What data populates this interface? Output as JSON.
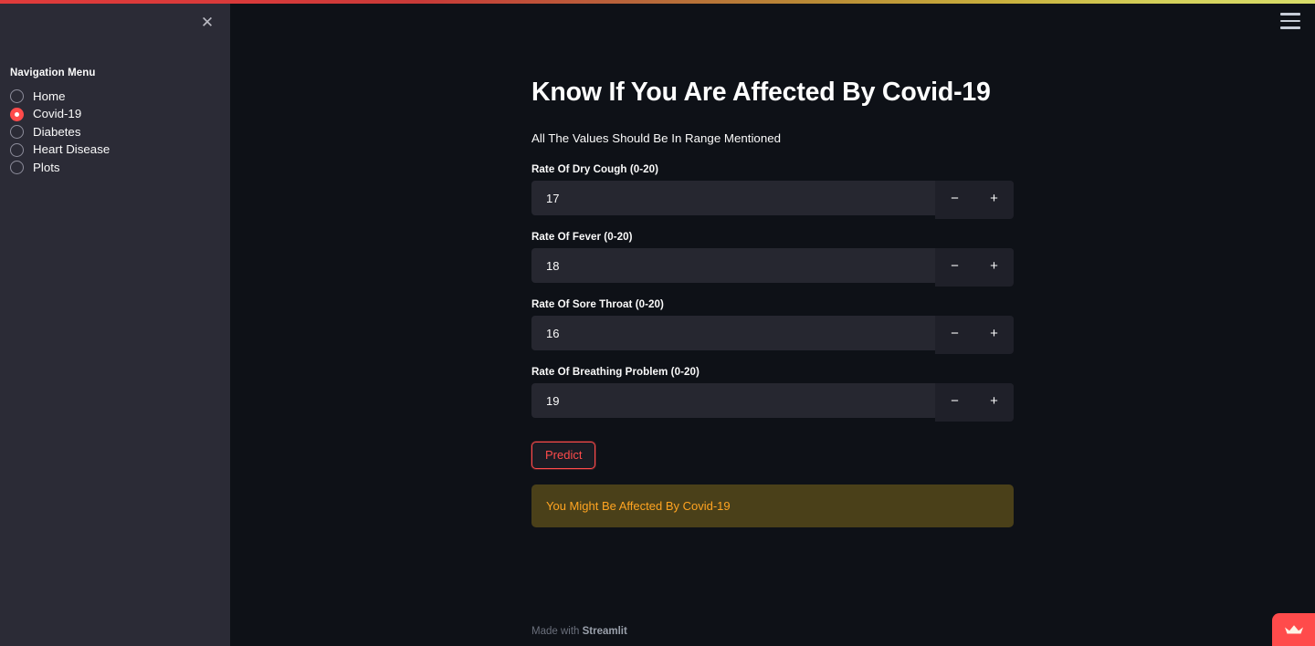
{
  "theme": {
    "background": "#0e1117",
    "sidebar_background": "#2b2b36",
    "accent": "#ff4b4b",
    "input_background": "#262730",
    "warning_background": "#4a4019",
    "warning_text": "#ffa421",
    "text": "#fafafa"
  },
  "top_bar": {
    "gradient_from": "#e03b3b",
    "gradient_to": "#d8dd6a"
  },
  "sidebar": {
    "close_icon": "close-icon",
    "close_glyph": "✕",
    "nav_label": "Navigation Menu",
    "items": [
      {
        "label": "Home",
        "selected": false
      },
      {
        "label": "Covid-19",
        "selected": true
      },
      {
        "label": "Diabetes",
        "selected": false
      },
      {
        "label": "Heart Disease",
        "selected": false
      },
      {
        "label": "Plots",
        "selected": false
      }
    ]
  },
  "header": {
    "menu_icon": "hamburger-menu-icon"
  },
  "main": {
    "title": "Know If You Are Affected By Covid-19",
    "subtitle": "All The Values Should Be In Range Mentioned",
    "fields": [
      {
        "label": "Rate Of Dry Cough (0-20)",
        "value": "17",
        "min": 0,
        "max": 20
      },
      {
        "label": "Rate Of Fever (0-20)",
        "value": "18",
        "min": 0,
        "max": 20
      },
      {
        "label": "Rate Of Sore Throat (0-20)",
        "value": "16",
        "min": 0,
        "max": 20
      },
      {
        "label": "Rate Of Breathing Problem (0-20)",
        "value": "19",
        "min": 0,
        "max": 20
      }
    ],
    "stepper": {
      "decrement_glyph": "−",
      "increment_glyph": "+"
    },
    "predict_label": "Predict",
    "alert_text": "You Might Be Affected By Covid-19"
  },
  "footer": {
    "made_with": "Made with ",
    "brand": "Streamlit"
  },
  "cloud_badge": {
    "icon": "streamlit-crown-icon"
  }
}
